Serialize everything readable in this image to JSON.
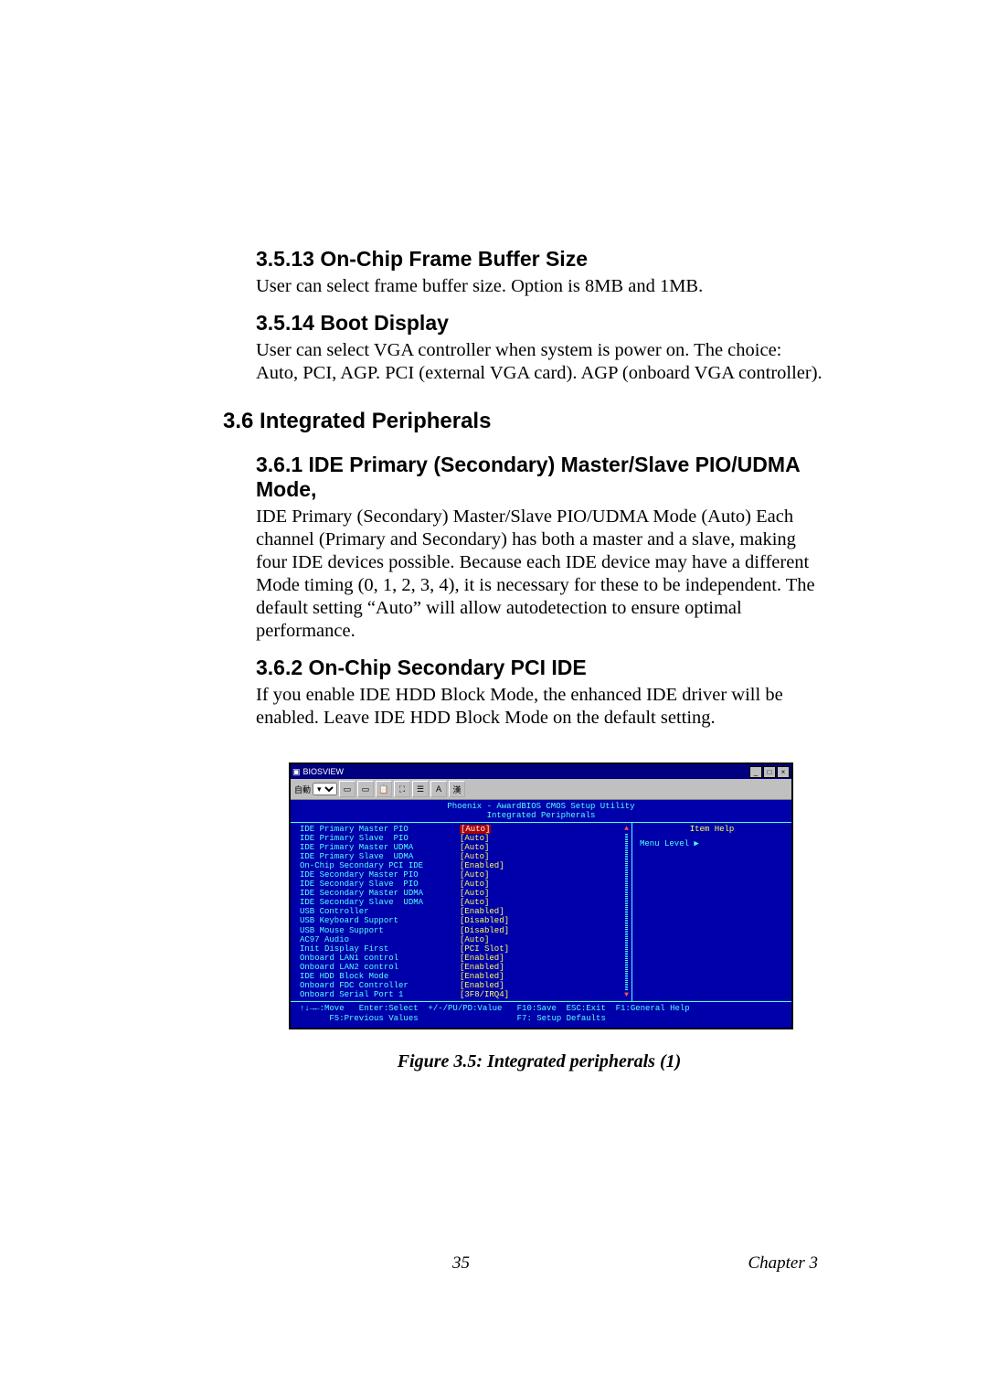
{
  "sections": {
    "s3513": {
      "heading": "3.5.13 On-Chip Frame Buffer Size",
      "body": "User can select frame buffer size.  Option is 8MB and 1MB."
    },
    "s3514": {
      "heading": "3.5.14 Boot Display",
      "body": "User can select VGA controller when system is power on.   The choice: Auto, PCI, AGP.   PCI (external VGA card).  AGP (onboard VGA controller)."
    },
    "s36": {
      "heading": "3.6  Integrated Peripherals"
    },
    "s361": {
      "heading": "3.6.1 IDE Primary (Secondary) Master/Slave PIO/UDMA Mode,",
      "body": "IDE Primary (Secondary) Master/Slave PIO/UDMA Mode (Auto) Each channel (Primary and Secondary) has both a master and a slave, making four IDE devices possible. Because each IDE device may have a different Mode timing (0, 1, 2, 3, 4), it is necessary for these to be independent. The default setting “Auto” will allow autodetection to ensure optimal performance."
    },
    "s362": {
      "heading": "3.6.2 On-Chip Secondary PCI IDE",
      "body": "If you enable IDE HDD Block Mode, the enhanced IDE driver will be enabled. Leave IDE HDD Block Mode on the default setting."
    }
  },
  "figure_caption": "Figure 3.5: Integrated peripherals (1)",
  "footer": {
    "page": "35",
    "chapter": "Chapter 3"
  },
  "screenshot": {
    "window_title": "BIOSVIEW",
    "toolbar_label": "自動",
    "bios_title1": "Phoenix - AwardBIOS CMOS Setup Utility",
    "bios_title2": "Integrated Peripherals",
    "help_title": "Item Help",
    "menu_level": "Menu Level   ▶",
    "footer1": "↑↓→←:Move   Enter:Select  +/-/PU/PD:Value   F10:Save  ESC:Exit  F1:General Help",
    "footer2": "      F5:Previous Values                    F7: Setup Defaults",
    "rows": [
      {
        "label": "IDE Primary Master PIO",
        "value": "Auto",
        "selected": true
      },
      {
        "label": "IDE Primary Slave  PIO",
        "value": "Auto"
      },
      {
        "label": "IDE Primary Master UDMA",
        "value": "Auto"
      },
      {
        "label": "IDE Primary Slave  UDMA",
        "value": "Auto"
      },
      {
        "label": "On-Chip Secondary PCI IDE",
        "value": "Enabled"
      },
      {
        "label": "IDE Secondary Master PIO",
        "value": "Auto"
      },
      {
        "label": "IDE Secondary Slave  PIO",
        "value": "Auto"
      },
      {
        "label": "IDE Secondary Master UDMA",
        "value": "Auto"
      },
      {
        "label": "IDE Secondary Slave  UDMA",
        "value": "Auto"
      },
      {
        "label": "USB Controller",
        "value": "Enabled"
      },
      {
        "label": "USB Keyboard Support",
        "value": "Disabled"
      },
      {
        "label": "USB Mouse Support",
        "value": "Disabled"
      },
      {
        "label": "AC97 Audio",
        "value": "Auto"
      },
      {
        "label": "Init Display First",
        "value": "PCI Slot"
      },
      {
        "label": "Onboard LAN1 control",
        "value": "Enabled"
      },
      {
        "label": "Onboard LAN2 control",
        "value": "Enabled"
      },
      {
        "label": "IDE HDD Block Mode",
        "value": "Enabled"
      },
      {
        "label": "Onboard FDC Controller",
        "value": "Enabled"
      },
      {
        "label": "Onboard Serial Port 1",
        "value": "3F8/IRQ4"
      }
    ]
  }
}
